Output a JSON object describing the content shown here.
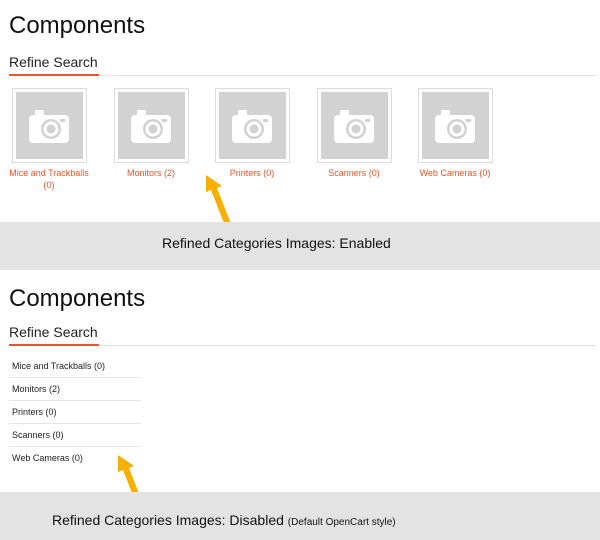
{
  "panel_enabled": {
    "page_title": "Components",
    "refine_heading": "Refine Search",
    "categories": [
      {
        "name": "Mice and Trackballs",
        "count": "(0)",
        "icon": "camera-placeholder-icon"
      },
      {
        "name": "Monitors (2)",
        "icon": "camera-placeholder-icon"
      },
      {
        "name": "Printers (0)",
        "icon": "camera-placeholder-icon"
      },
      {
        "name": "Scanners (0)",
        "icon": "camera-placeholder-icon"
      },
      {
        "name": "Web Cameras (0)",
        "icon": "camera-placeholder-icon"
      }
    ],
    "caption": "Refined Categories Images: Enabled"
  },
  "panel_disabled": {
    "page_title": "Components",
    "refine_heading": "Refine Search",
    "categories": [
      {
        "name": "Mice and Trackballs (0)"
      },
      {
        "name": "Monitors (2)"
      },
      {
        "name": "Printers (0)"
      },
      {
        "name": "Scanners (0)"
      },
      {
        "name": "Web Cameras (0)"
      }
    ],
    "caption": "Refined Categories Images: Disabled",
    "caption_note": "(Default OpenCart style)"
  },
  "colors": {
    "link": "#e8562a",
    "accent_underline": "#e8562a",
    "banner_bg": "#e3e3e3",
    "arrow": "#f5b000",
    "thumb_bg": "#d2d2d2"
  }
}
